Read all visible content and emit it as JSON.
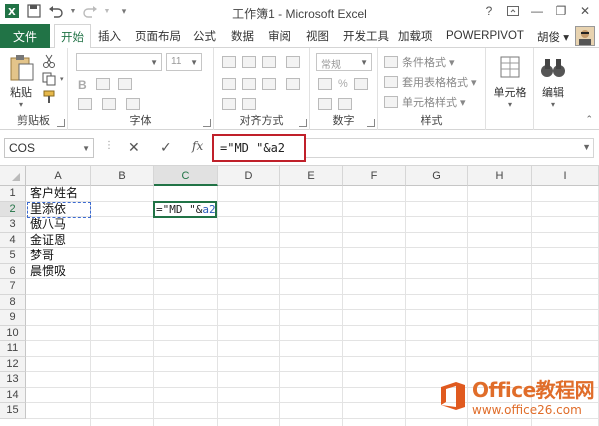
{
  "window": {
    "title": "工作簿1 - Microsoft Excel",
    "help": "?",
    "min": "—",
    "restore": "❐",
    "close": "✕"
  },
  "ribbon_tabs": {
    "file": "文件",
    "items": [
      "开始",
      "插入",
      "页面布局",
      "公式",
      "数据",
      "审阅",
      "视图",
      "开发工具",
      "加载项",
      "POWERPIVOT"
    ],
    "active": "开始",
    "user": "胡俊 ▾"
  },
  "ribbon": {
    "clipboard": {
      "paste": "粘贴",
      "label": "剪贴板"
    },
    "font": {
      "size": "11",
      "label": "字体",
      "bold": "B"
    },
    "alignment": {
      "label": "对齐方式"
    },
    "number": {
      "format": "常规",
      "label": "数字",
      "percent": "%"
    },
    "styles": {
      "conditional": "条件格式 ▾",
      "table": "套用表格格式 ▾",
      "cell_styles": "单元格样式 ▾",
      "label": "样式"
    },
    "cells": {
      "label": "单元格"
    },
    "editing": {
      "label": "编辑"
    }
  },
  "formula_bar": {
    "name_box": "COS",
    "cancel": "✕",
    "enter": "✓",
    "fx": "fx",
    "formula": "=\"MD \"&a2"
  },
  "grid": {
    "columns": [
      "A",
      "B",
      "C",
      "D",
      "E",
      "F",
      "G",
      "H",
      "I"
    ],
    "rows": [
      "1",
      "2",
      "3",
      "4",
      "5",
      "6",
      "7",
      "8",
      "9",
      "10",
      "11",
      "12",
      "13",
      "14",
      "15"
    ],
    "selected_column": "C",
    "selected_row": "2",
    "cells_A": [
      "客户姓名",
      "里添依",
      "傲八马",
      "金证恩",
      "梦哥",
      "晨惯吸"
    ],
    "editing_cell": {
      "prefix": "=\"MD \"&",
      "ref": "a2"
    }
  },
  "watermark": {
    "brand": "Office教程网",
    "url": "www.office26.com"
  },
  "colors": {
    "excel_green": "#217346",
    "highlight_red": "#c0202a",
    "logo_orange": "#e06d2a"
  }
}
